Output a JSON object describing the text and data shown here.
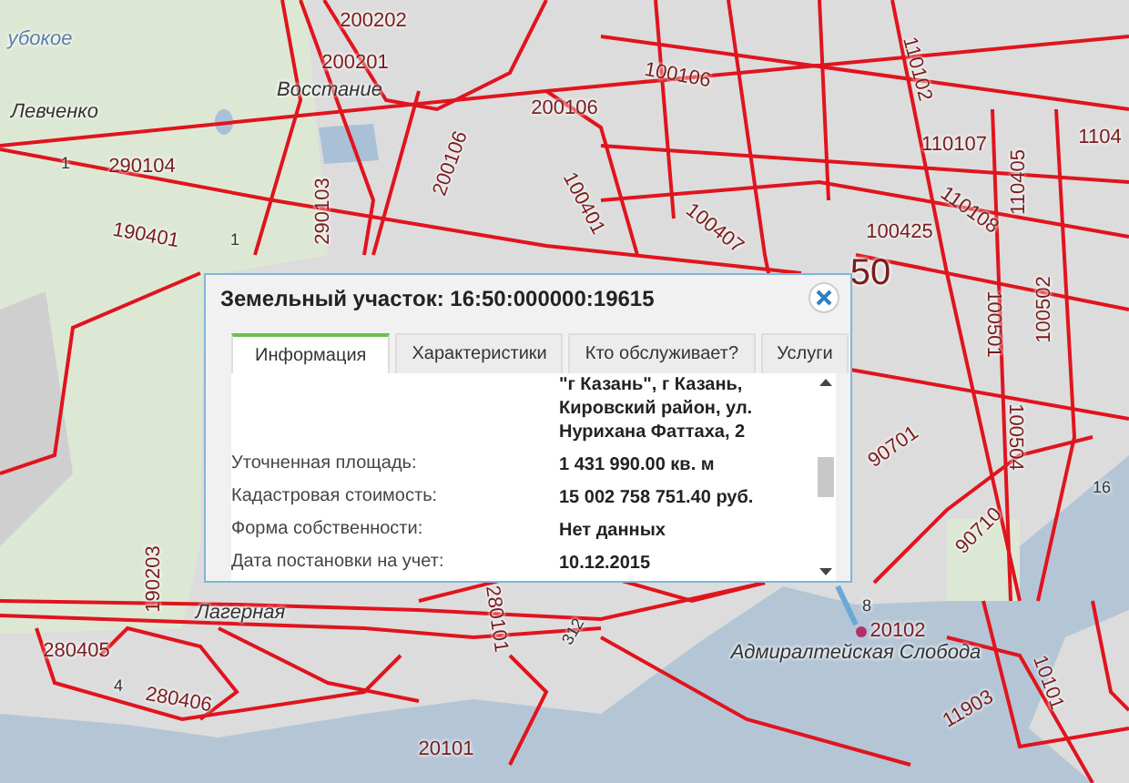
{
  "map": {
    "labels": [
      {
        "text": "200202",
        "kind": "parcel"
      },
      {
        "text": "убокое",
        "kind": "water"
      },
      {
        "text": "200201",
        "kind": "parcel"
      },
      {
        "text": "110102",
        "kind": "parcel"
      },
      {
        "text": "100106",
        "kind": "parcel"
      },
      {
        "text": "Восстание",
        "kind": "place"
      },
      {
        "text": "200106",
        "kind": "parcel"
      },
      {
        "text": "Левченко",
        "kind": "place"
      },
      {
        "text": "110107",
        "kind": "parcel"
      },
      {
        "text": "1104",
        "kind": "parcel"
      },
      {
        "text": "200106",
        "kind": "parcel"
      },
      {
        "text": "290104",
        "kind": "parcel"
      },
      {
        "text": "1",
        "kind": "small"
      },
      {
        "text": "110405",
        "kind": "parcel"
      },
      {
        "text": "290103",
        "kind": "parcel"
      },
      {
        "text": "100401",
        "kind": "parcel"
      },
      {
        "text": "110108",
        "kind": "parcel"
      },
      {
        "text": "190401",
        "kind": "parcel"
      },
      {
        "text": "100407",
        "kind": "parcel"
      },
      {
        "text": "100425",
        "kind": "parcel"
      },
      {
        "text": "1",
        "kind": "small"
      },
      {
        "text": "50",
        "kind": "quarter"
      },
      {
        "text": "100501",
        "kind": "parcel"
      },
      {
        "text": "100502",
        "kind": "parcel"
      },
      {
        "text": "100504",
        "kind": "parcel"
      },
      {
        "text": "90701",
        "kind": "parcel"
      },
      {
        "text": "16",
        "kind": "small"
      },
      {
        "text": "90710",
        "kind": "parcel"
      },
      {
        "text": "190203",
        "kind": "parcel"
      },
      {
        "text": "280101",
        "kind": "parcel"
      },
      {
        "text": "8",
        "kind": "small"
      },
      {
        "text": "Лагерная",
        "kind": "place"
      },
      {
        "text": "20102",
        "kind": "parcel"
      },
      {
        "text": "312",
        "kind": "small"
      },
      {
        "text": "280405",
        "kind": "parcel"
      },
      {
        "text": "Адмиралтейская Слобода",
        "kind": "place"
      },
      {
        "text": "10101",
        "kind": "parcel"
      },
      {
        "text": "4",
        "kind": "small"
      },
      {
        "text": "280406",
        "kind": "parcel"
      },
      {
        "text": "11903",
        "kind": "parcel"
      },
      {
        "text": "20101",
        "kind": "parcel"
      }
    ]
  },
  "popup": {
    "title": "Земельный участок: 16:50:000000:19615",
    "tabs": [
      {
        "label": "Информация",
        "selected": true
      },
      {
        "label": "Характеристики",
        "selected": false
      },
      {
        "label": "Кто обслуживает?",
        "selected": false
      },
      {
        "label": "Услуги",
        "selected": false
      }
    ],
    "rows": [
      {
        "label": "",
        "value": "\"г Казань\", г Казань, Кировский район, ул. Нурихана Фаттаха, 2"
      },
      {
        "label": "Уточненная площадь:",
        "value": "1 431 990.00 кв. м"
      },
      {
        "label": "Кадастровая стоимость:",
        "value": "15 002 758 751.40 руб."
      },
      {
        "label": "Форма собственности:",
        "value": "Нет данных"
      },
      {
        "label": "Дата постановки на учет:",
        "value": "10.12.2015"
      }
    ]
  }
}
